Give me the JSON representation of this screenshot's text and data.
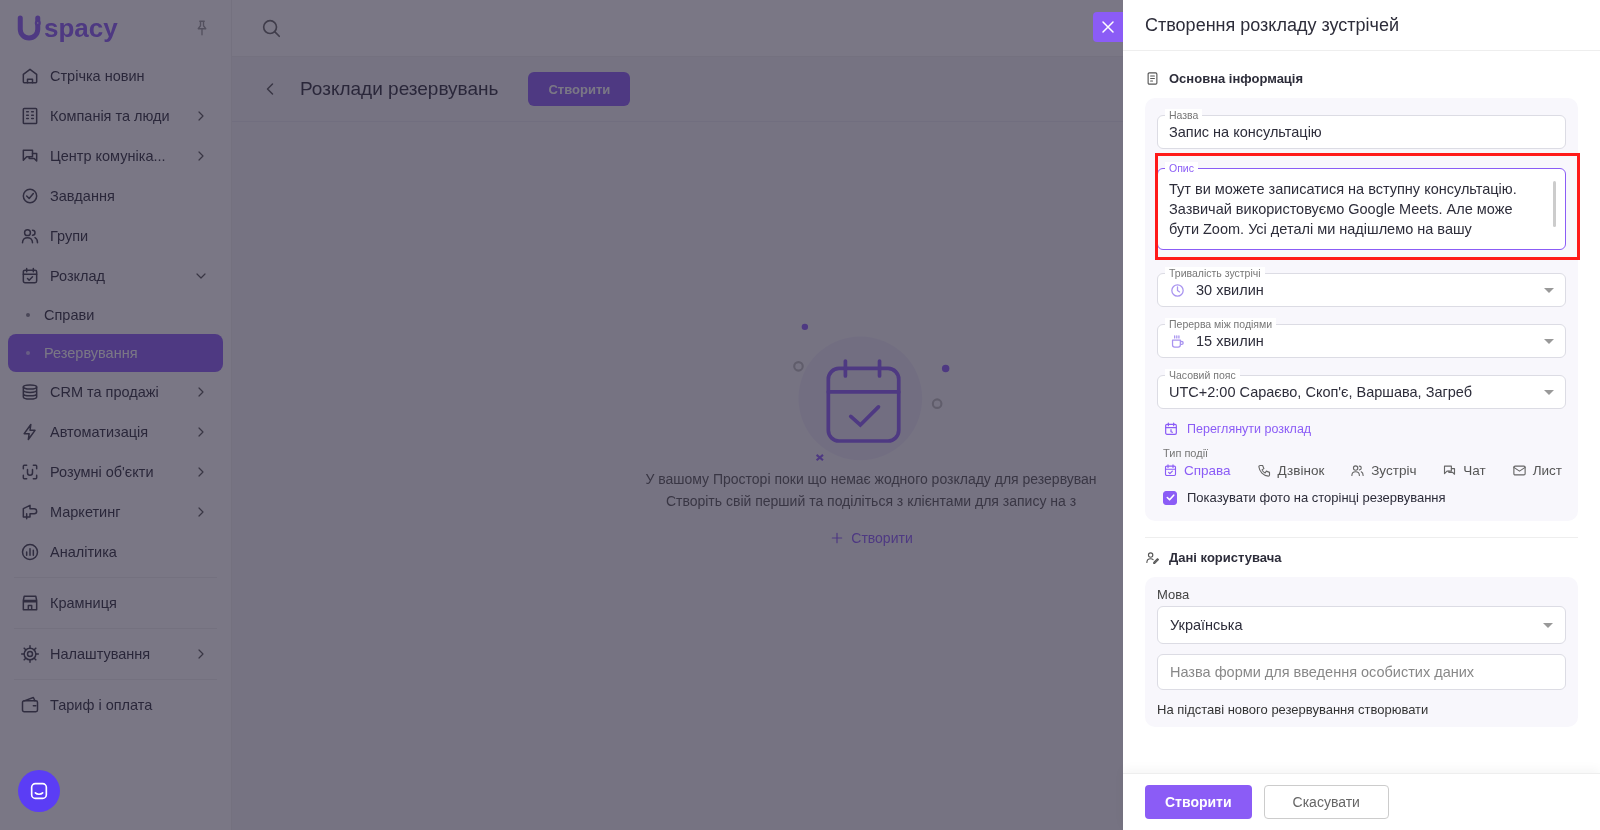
{
  "sidebar": {
    "logo_text": "spacy",
    "items": [
      {
        "label": "Стрічка новин",
        "expandable": false
      },
      {
        "label": "Компанія та люди",
        "expandable": true,
        "expanded": false
      },
      {
        "label": "Центр комуніка...",
        "expandable": true,
        "expanded": false
      },
      {
        "label": "Завдання",
        "expandable": false
      },
      {
        "label": "Групи",
        "expandable": false
      },
      {
        "label": "Розклад",
        "expandable": true,
        "expanded": true,
        "children": [
          {
            "label": "Справи",
            "selected": false
          },
          {
            "label": "Резервування",
            "selected": true
          }
        ]
      },
      {
        "label": "CRM та продажі",
        "expandable": true,
        "expanded": false
      },
      {
        "label": "Автоматизація",
        "expandable": true,
        "expanded": false
      },
      {
        "label": "Розумні об'єкти",
        "expandable": true,
        "expanded": false
      },
      {
        "label": "Маркетинг",
        "expandable": true,
        "expanded": false
      },
      {
        "label": "Аналітика",
        "expandable": false
      },
      {
        "label": "Крамниця",
        "expandable": false
      },
      {
        "label": "Налаштування",
        "expandable": true,
        "expanded": false
      },
      {
        "label": "Тариф і оплата",
        "expandable": false
      }
    ]
  },
  "main": {
    "title": "Розклади резервувань",
    "create_button": "Створити",
    "empty_state": {
      "lines": [
        "У вашому Просторі поки що немає жодного розкладу для резервуван",
        "Створіть свій перший та поділіться з клієнтами для запису на з"
      ],
      "link": "Створити"
    }
  },
  "panel": {
    "title": "Створення розкладу зустрічей",
    "sections": [
      {
        "title": "Основна інформація",
        "fields": [
          {
            "kind": "text",
            "label": "Назва",
            "value": "Запис на консультацію"
          },
          {
            "kind": "textarea",
            "label": "Опис",
            "value": "Тут ви можете записатися на вступну консультацію. Зазвичай використовуємо Google Meets. Але може бути Zoom. Усі деталі ми надішлемо на вашу",
            "focused": true
          },
          {
            "kind": "select",
            "label": "Тривалість зустрічі",
            "value": "30 хвилин"
          },
          {
            "kind": "select",
            "label": "Перерва між подіями",
            "value": "15 хвилин"
          },
          {
            "kind": "select",
            "label": "Часовий пояс",
            "value": "UTC+2:00 Сараєво, Скоп'є, Варшава, Загреб"
          }
        ],
        "link": "Переглянути розклад",
        "event_type": {
          "label": "Тип події",
          "options": [
            {
              "label": "Справа",
              "selected": true
            },
            {
              "label": "Дзвінок",
              "selected": false
            },
            {
              "label": "Зустріч",
              "selected": false
            },
            {
              "label": "Чат",
              "selected": false
            },
            {
              "label": "Лист",
              "selected": false
            }
          ]
        },
        "checkbox": {
          "label": "Показувати фото на сторінці резервування",
          "checked": true
        }
      },
      {
        "title": "Дані користувача",
        "language": {
          "label": "Мова",
          "value": "Українська"
        },
        "form_name": {
          "placeholder": "Назва форми для введення особистих даних"
        },
        "note": "На підставі нового резервування створювати"
      }
    ],
    "buttons": [
      {
        "label": "Створити",
        "kind": "primary"
      },
      {
        "label": "Скасувати",
        "kind": "secondary"
      }
    ]
  }
}
